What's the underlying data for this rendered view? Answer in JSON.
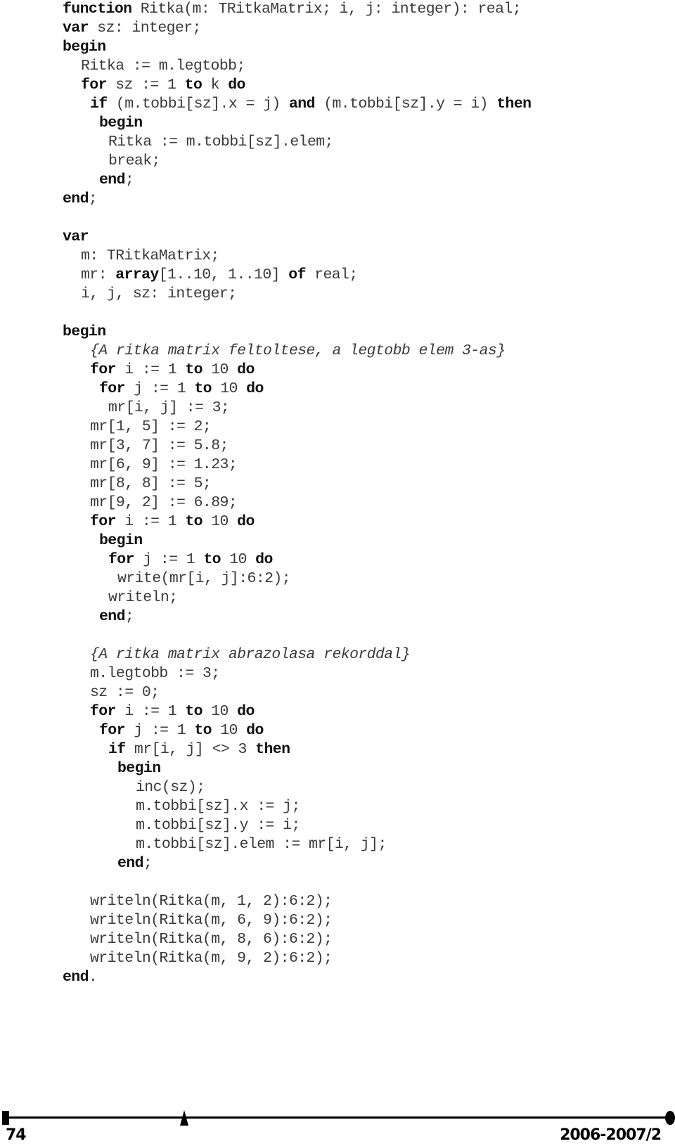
{
  "code_lines": [
    {
      "indent": 0,
      "tokens": [
        {
          "t": "function",
          "k": 1
        },
        {
          "t": " Ritka(m: TRitkaMatrix; i, j: integer): real;"
        }
      ]
    },
    {
      "indent": 0,
      "tokens": [
        {
          "t": "var",
          "k": 1
        },
        {
          "t": " sz: integer;"
        }
      ]
    },
    {
      "indent": 0,
      "tokens": [
        {
          "t": "begin",
          "k": 1
        }
      ]
    },
    {
      "indent": 2,
      "tokens": [
        {
          "t": "Ritka := m.legtobb;"
        }
      ]
    },
    {
      "indent": 2,
      "tokens": [
        {
          "t": "for",
          "k": 1
        },
        {
          "t": " sz := 1 "
        },
        {
          "t": "to",
          "k": 1
        },
        {
          "t": " k "
        },
        {
          "t": "do",
          "k": 1
        }
      ]
    },
    {
      "indent": 3,
      "tokens": [
        {
          "t": "if",
          "k": 1
        },
        {
          "t": " (m.tobbi[sz].x = j) "
        },
        {
          "t": "and",
          "k": 1
        },
        {
          "t": " (m.tobbi[sz].y = i) "
        },
        {
          "t": "then",
          "k": 1
        }
      ]
    },
    {
      "indent": 4,
      "tokens": [
        {
          "t": "begin",
          "k": 1
        }
      ]
    },
    {
      "indent": 5,
      "tokens": [
        {
          "t": "Ritka := m.tobbi[sz].elem;"
        }
      ]
    },
    {
      "indent": 5,
      "tokens": [
        {
          "t": "break;"
        }
      ]
    },
    {
      "indent": 4,
      "tokens": [
        {
          "t": "end",
          "k": 1
        },
        {
          "t": ";"
        }
      ]
    },
    {
      "indent": 0,
      "tokens": [
        {
          "t": "end",
          "k": 1
        },
        {
          "t": ";"
        }
      ]
    },
    {
      "indent": 0,
      "tokens": []
    },
    {
      "indent": 0,
      "tokens": [
        {
          "t": "var",
          "k": 1
        }
      ]
    },
    {
      "indent": 2,
      "tokens": [
        {
          "t": "m: TRitkaMatrix;"
        }
      ]
    },
    {
      "indent": 2,
      "tokens": [
        {
          "t": "mr: "
        },
        {
          "t": "array",
          "k": 1
        },
        {
          "t": "[1..10, 1..10] "
        },
        {
          "t": "of",
          "k": 1
        },
        {
          "t": " real;"
        }
      ]
    },
    {
      "indent": 2,
      "tokens": [
        {
          "t": "i, j, sz: integer;"
        }
      ]
    },
    {
      "indent": 0,
      "tokens": []
    },
    {
      "indent": 0,
      "tokens": [
        {
          "t": "begin",
          "k": 1
        }
      ]
    },
    {
      "indent": 3,
      "tokens": [
        {
          "t": "{A ritka matrix feltoltese, a legtobb elem 3-as}",
          "c": 1
        }
      ]
    },
    {
      "indent": 3,
      "tokens": [
        {
          "t": "for",
          "k": 1
        },
        {
          "t": " i := 1 "
        },
        {
          "t": "to",
          "k": 1
        },
        {
          "t": " 10 "
        },
        {
          "t": "do",
          "k": 1
        }
      ]
    },
    {
      "indent": 4,
      "tokens": [
        {
          "t": "for",
          "k": 1
        },
        {
          "t": " j := 1 "
        },
        {
          "t": "to",
          "k": 1
        },
        {
          "t": " 10 "
        },
        {
          "t": "do",
          "k": 1
        }
      ]
    },
    {
      "indent": 5,
      "tokens": [
        {
          "t": "mr[i, j] := 3;"
        }
      ]
    },
    {
      "indent": 3,
      "tokens": [
        {
          "t": "mr[1, 5] := 2;"
        }
      ]
    },
    {
      "indent": 3,
      "tokens": [
        {
          "t": "mr[3, 7] := 5.8;"
        }
      ]
    },
    {
      "indent": 3,
      "tokens": [
        {
          "t": "mr[6, 9] := 1.23;"
        }
      ]
    },
    {
      "indent": 3,
      "tokens": [
        {
          "t": "mr[8, 8] := 5;"
        }
      ]
    },
    {
      "indent": 3,
      "tokens": [
        {
          "t": "mr[9, 2] := 6.89;"
        }
      ]
    },
    {
      "indent": 3,
      "tokens": [
        {
          "t": "for",
          "k": 1
        },
        {
          "t": " i := 1 "
        },
        {
          "t": "to",
          "k": 1
        },
        {
          "t": " 10 "
        },
        {
          "t": "do",
          "k": 1
        }
      ]
    },
    {
      "indent": 4,
      "tokens": [
        {
          "t": "begin",
          "k": 1
        }
      ]
    },
    {
      "indent": 5,
      "tokens": [
        {
          "t": "for",
          "k": 1
        },
        {
          "t": " j := 1 "
        },
        {
          "t": "to",
          "k": 1
        },
        {
          "t": " 10 "
        },
        {
          "t": "do",
          "k": 1
        }
      ]
    },
    {
      "indent": 6,
      "tokens": [
        {
          "t": "write(mr[i, j]:6:2);"
        }
      ]
    },
    {
      "indent": 5,
      "tokens": [
        {
          "t": "writeln;"
        }
      ]
    },
    {
      "indent": 4,
      "tokens": [
        {
          "t": "end",
          "k": 1
        },
        {
          "t": ";"
        }
      ]
    },
    {
      "indent": 0,
      "tokens": []
    },
    {
      "indent": 3,
      "tokens": [
        {
          "t": "{A ritka matrix abrazolasa rekorddal}",
          "c": 1
        }
      ]
    },
    {
      "indent": 3,
      "tokens": [
        {
          "t": "m.legtobb := 3;"
        }
      ]
    },
    {
      "indent": 3,
      "tokens": [
        {
          "t": "sz := 0;"
        }
      ]
    },
    {
      "indent": 3,
      "tokens": [
        {
          "t": "for",
          "k": 1
        },
        {
          "t": " i := 1 "
        },
        {
          "t": "to",
          "k": 1
        },
        {
          "t": " 10 "
        },
        {
          "t": "do",
          "k": 1
        }
      ]
    },
    {
      "indent": 4,
      "tokens": [
        {
          "t": "for",
          "k": 1
        },
        {
          "t": " j := 1 "
        },
        {
          "t": "to",
          "k": 1
        },
        {
          "t": " 10 "
        },
        {
          "t": "do",
          "k": 1
        }
      ]
    },
    {
      "indent": 5,
      "tokens": [
        {
          "t": "if",
          "k": 1
        },
        {
          "t": " mr[i, j] <> 3 "
        },
        {
          "t": "then",
          "k": 1
        }
      ]
    },
    {
      "indent": 6,
      "tokens": [
        {
          "t": "begin",
          "k": 1
        }
      ]
    },
    {
      "indent": 8,
      "tokens": [
        {
          "t": "inc(sz);"
        }
      ]
    },
    {
      "indent": 8,
      "tokens": [
        {
          "t": "m.tobbi[sz].x := j;"
        }
      ]
    },
    {
      "indent": 8,
      "tokens": [
        {
          "t": "m.tobbi[sz].y := i;"
        }
      ]
    },
    {
      "indent": 8,
      "tokens": [
        {
          "t": "m.tobbi[sz].elem := mr[i, j];"
        }
      ]
    },
    {
      "indent": 6,
      "tokens": [
        {
          "t": "end",
          "k": 1
        },
        {
          "t": ";"
        }
      ]
    },
    {
      "indent": 0,
      "tokens": []
    },
    {
      "indent": 3,
      "tokens": [
        {
          "t": "writeln(Ritka(m, 1, 2):6:2);"
        }
      ]
    },
    {
      "indent": 3,
      "tokens": [
        {
          "t": "writeln(Ritka(m, 6, 9):6:2);"
        }
      ]
    },
    {
      "indent": 3,
      "tokens": [
        {
          "t": "writeln(Ritka(m, 8, 6):6:2);"
        }
      ]
    },
    {
      "indent": 3,
      "tokens": [
        {
          "t": "writeln(Ritka(m, 9, 2):6:2);"
        }
      ]
    },
    {
      "indent": 0,
      "tokens": [
        {
          "t": "end",
          "k": 1
        },
        {
          "t": "."
        }
      ]
    }
  ],
  "footer": {
    "page_number": "74",
    "issue": "2006-2007/2"
  }
}
